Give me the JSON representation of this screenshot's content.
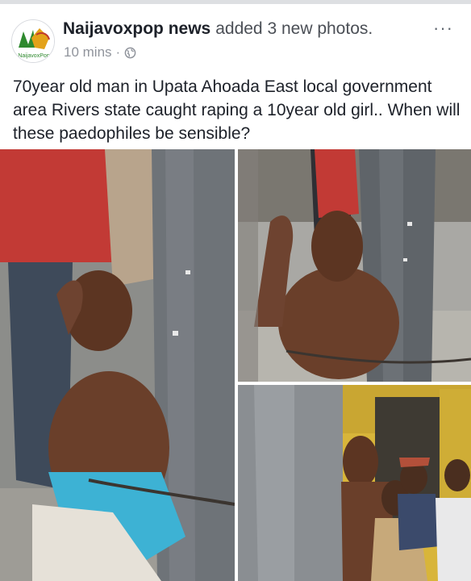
{
  "post": {
    "author": "Naijavoxpop news",
    "action": "added 3 new photos.",
    "time": "10 mins",
    "separator": "·",
    "privacy_icon": "globe-icon",
    "more_label": "···",
    "avatar_label": "NaijavoxPop",
    "text": "70year old man in Upata Ahoada East local government area Rivers state caught raping a 10year old girl.. When will these paedophiles be sensible?"
  },
  "photos": [
    {
      "name": "photo-1",
      "description_icon": "photo"
    },
    {
      "name": "photo-2",
      "description_icon": "photo"
    },
    {
      "name": "photo-3",
      "description_icon": "photo"
    }
  ],
  "colors": {
    "author": "#1d2129",
    "meta": "#90949c",
    "pillar": "#6e7378",
    "wall_yellow": "#d8b53a"
  }
}
